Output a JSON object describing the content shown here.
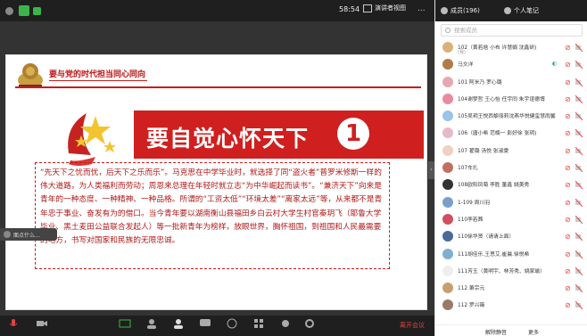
{
  "window": {
    "time": "58:54",
    "view_label": "演讲者视图",
    "more": "..."
  },
  "slide": {
    "header_title": "要与党的时代担当同心同向",
    "banner_text": "要自觉心怀天下",
    "banner_number": "1",
    "body": "“先天下之忧而忧，后天下之乐而乐”。马克思在中学毕业时，就选择了同“盗火者”普罗米修斯一样的伟大道路，为人类福利而劳动；周恩来总理在年轻时就立志“为中华崛起而读书”。“兼济天下”向来是青年的一种态度、一种精神、一种品格。所谓的“工资太低”“环境太差”“离家太远”等，从来都不是青年忠于事业、奋发有为的借口。当今青年要以湖南衡山县福田乡白云村大学生村官秦玥飞（耶鲁大学毕业、黑土麦田公益联合发起人）等一批新青年为榜样，放眼世界，胸怀祖国，到祖国和人民最需要的地方，书写对国家和民族的无限忠诚。",
    "speaker_tab": "面点什么…"
  },
  "toolbar": {
    "leave_label": "离开会议"
  },
  "panel": {
    "members_label": "成员(196)",
    "notes_label": "个人笔记",
    "search_placeholder": "搜索成员",
    "members": [
      {
        "name": "102（黄若晗 小布 许慧娟 沈鑫研)",
        "sub": "(我)",
        "color": "#d9b27a"
      },
      {
        "name": "马文洋",
        "sub": "",
        "color": "#b07a4a",
        "extra": "◐"
      },
      {
        "name": "101 阿米乃 罗心璐",
        "sub": "",
        "color": "#e7a9b0"
      },
      {
        "name": "104谢梦哲 王心怡 任宇同 朱宇谊德博",
        "sub": "",
        "color": "#e98aa0"
      },
      {
        "name": "105吴玥王悦西黎丽莉沈燕华悦健玺慧雨馨",
        "sub": "",
        "color": "#9ac4e8"
      },
      {
        "name": "106（唐小希 范楠一 彭好徐 张玥)",
        "sub": "",
        "color": "#e9b8c8"
      },
      {
        "name": "107 翟璐 汤悦 张淑雯",
        "sub": "",
        "color": "#f0d0c0"
      },
      {
        "name": "107车扎",
        "sub": "",
        "color": "#c07060"
      },
      {
        "name": "108欧阳凤菊 李胜 董鑫 姚美秀",
        "sub": "",
        "color": "#333333"
      },
      {
        "name": "1-109 周川羽",
        "sub": "",
        "color": "#7aa0c8"
      },
      {
        "name": "110李若茜",
        "sub": "",
        "color": "#d05060"
      },
      {
        "name": "110徐华贤（请请上面）",
        "sub": "",
        "color": "#4a6a9a"
      },
      {
        "name": "111胡佳乐.王思艾.崔晨.徐悦希",
        "sub": "",
        "color": "#80b0d0"
      },
      {
        "name": "111芳玉（黄明宇、林芳秀、姚家瑜）",
        "sub": "",
        "color": "#eeeeee"
      },
      {
        "name": "112 萧宗元",
        "sub": "",
        "color": "#c8a070"
      },
      {
        "name": "112 罗兴薇",
        "sub": "",
        "color": "#9a7a6a"
      }
    ],
    "mute_all": "解除静音",
    "more": "更多"
  }
}
